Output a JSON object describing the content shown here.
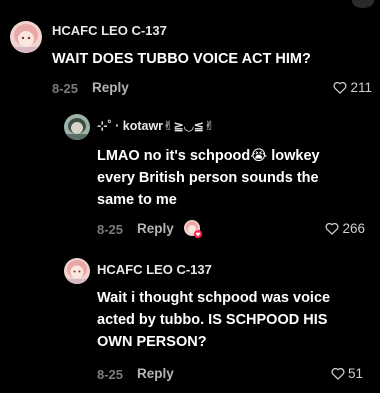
{
  "comments": [
    {
      "username": "HCAFC LEO C-137",
      "text": "WAIT DOES TUBBO VOICE ACT HIM?",
      "date": "8-25",
      "reply_label": "Reply",
      "likes": "211"
    },
    {
      "username": "⊹˚ · kotawr✌︎≧◡≦✌︎",
      "text": "LMAO no it's schpood😭 lowkey every British person sounds the same to me",
      "date": "8-25",
      "reply_label": "Reply",
      "likes": "266"
    },
    {
      "username": "HCAFC LEO C-137",
      "text": "Wait i thought schpood was voice acted by tubbo. IS SCHPOOD HIS OWN PERSON?",
      "date": "8-25",
      "reply_label": "Reply",
      "likes": "51"
    }
  ],
  "icons": {
    "like": "heart-outline-icon",
    "creator_liked": "creator-liked-avatar-icon",
    "more": "more-icon"
  },
  "colors": {
    "background": "#000000",
    "meta_gray": "#7a7a7a",
    "reply_gray": "#b5b5b5"
  }
}
